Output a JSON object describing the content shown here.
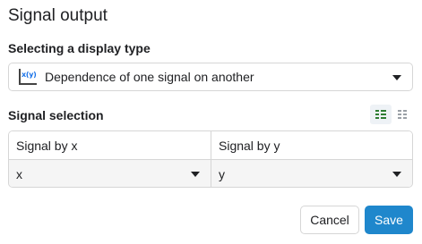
{
  "dialog": {
    "title": "Signal output"
  },
  "display_type": {
    "label": "Selecting a display type",
    "icon": "xy-dependence-icon",
    "icon_text": "x(y)",
    "selected": "Dependence of one signal on another"
  },
  "signal_selection": {
    "heading": "Signal selection",
    "layout_options": [
      "rows-layout-icon",
      "columns-layout-icon"
    ],
    "columns": [
      "Signal by x",
      "Signal by y"
    ],
    "values": [
      "x",
      "y"
    ]
  },
  "actions": {
    "cancel_label": "Cancel",
    "save_label": "Save"
  },
  "colors": {
    "primary": "#1f87cc",
    "accent_icon": "#1a73e8",
    "active_layout": "#2e7d32",
    "border": "#d6d6d6"
  }
}
